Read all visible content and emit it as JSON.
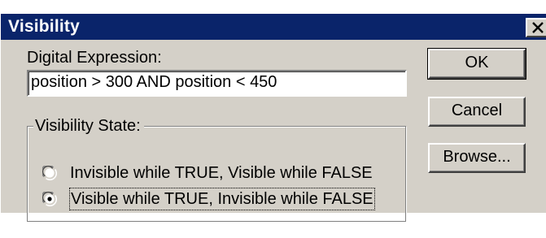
{
  "dialog": {
    "title": "Visibility",
    "close_icon": "close-icon"
  },
  "expression": {
    "label": "Digital Expression:",
    "value": "position > 300 AND position < 450"
  },
  "visibility_state": {
    "legend": "Visibility State:",
    "options": [
      {
        "label": "Invisible while TRUE, Visible while FALSE",
        "selected": false
      },
      {
        "label": "Visible while TRUE, Invisible while FALSE",
        "selected": true
      }
    ]
  },
  "buttons": {
    "ok": "OK",
    "cancel": "Cancel",
    "browse": "Browse..."
  },
  "colors": {
    "titlebar": "#0a246a",
    "face": "#d4d0c8"
  }
}
